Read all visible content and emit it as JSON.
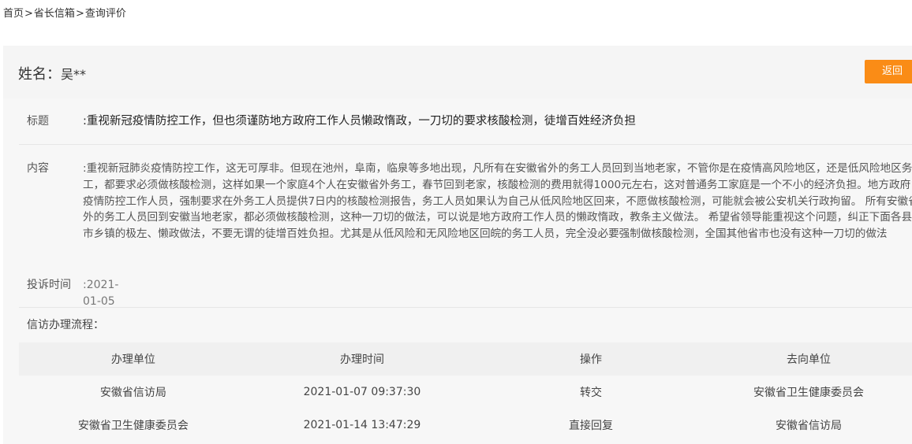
{
  "breadcrumb": {
    "items": [
      "首页",
      "省长信箱",
      "查询评价"
    ],
    "separator": ">"
  },
  "header": {
    "name_label": "姓名：",
    "name_value": "吴**",
    "back_label": "返回",
    "back_color": "#fa8c16"
  },
  "detail": {
    "title_label": "标题",
    "title_value": ":重视新冠疫情防控工作，但也须谨防地方政府工作人员懒政惰政，一刀切的要求核酸检测，徒增百姓经济负担",
    "content_label": "内容",
    "content_value": ":重视新冠肺炎疫情防控工作，这无可厚非。但现在池州，阜南，临泉等多地出现，凡所有在安徽省外的务工人员回到当地老家，不管你是在疫情高风险地区，还是低风险地区务工，都要求必须做核酸检测，这样如果一个家庭4个人在安徽省外务工，春节回到老家，核酸检测的费用就得1000元左右，这对普通务工家庭是一个不小的经济负担。地方政府疫情防控工作人员，强制要求在外务工人员提供7日内的核酸检测报告，务工人员如果认为自己从低风险地区回来，不愿做核酸检测，可能就会被公安机关行政拘留。 所有安徽省外的务工人员回到安徽当地老家，都必须做核酸检测，这种一刀切的做法，可以说是地方政府工作人员的懒政惰政，教条主义做法。 希望省领导能重视这个问题，纠正下面各县市乡镇的极左、懒政做法，不要无谓的徒增百姓负担。尤其是从低风险和无风险地区回皖的务工人员，完全没必要强制做核酸检测，全国其他省市也没有这种一刀切的做法",
    "date_label": "投诉时间",
    "date_value": ":2021-01-05"
  },
  "flow": {
    "title": "信访办理流程：",
    "columns": [
      "办理单位",
      "办理时间",
      "操作",
      "去向单位"
    ],
    "rows": [
      [
        "安徽省信访局",
        "2021-01-07 09:37:30",
        "转交",
        "安徽省卫生健康委员会"
      ],
      [
        "安徽省卫生健康委员会",
        "2021-01-14 13:47:29",
        "直接回复",
        "安徽省信访局"
      ]
    ]
  }
}
